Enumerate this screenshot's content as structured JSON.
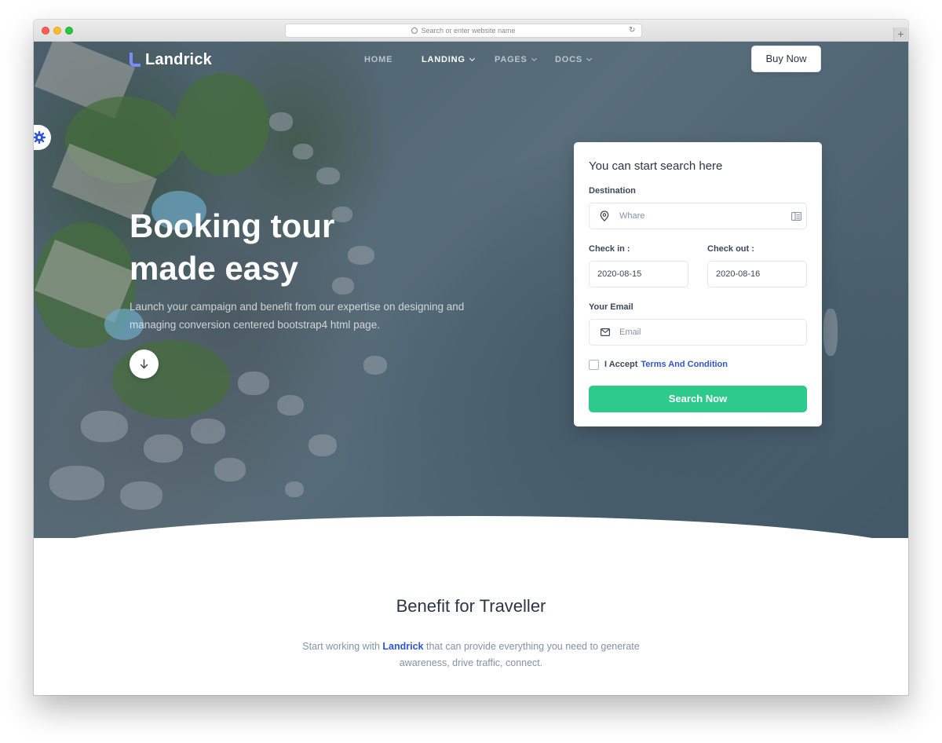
{
  "browser": {
    "url_placeholder": "Search or enter website name",
    "new_tab": "+"
  },
  "nav": {
    "logo": "Landrick",
    "items": [
      {
        "label": "HOME"
      },
      {
        "label": "LANDING"
      },
      {
        "label": "PAGES"
      },
      {
        "label": "DOCS"
      }
    ],
    "buy_button": "Buy Now"
  },
  "hero": {
    "title_line1": "Booking tour",
    "title_line2": "made easy",
    "subtitle": "Launch your campaign and benefit from our expertise on designing and managing conversion centered bootstrap4 html page."
  },
  "form": {
    "title": "You can start search here",
    "destination_label": "Destination",
    "destination_placeholder": "Whare",
    "checkin_label": "Check in :",
    "checkin_value": "2020-08-15",
    "checkout_label": "Check out :",
    "checkout_value": "2020-08-16",
    "email_label": "Your Email",
    "email_placeholder": "Email",
    "accept_text": "I Accept",
    "terms_link": "Terms And Condition",
    "submit": "Search Now"
  },
  "benefit": {
    "title": "Benefit for Traveller",
    "sub_pre": "Start working with",
    "sub_brand": "Landrick",
    "sub_post": "that can provide everything you need to generate awareness, drive traffic, connect."
  },
  "colors": {
    "primary": "#2f55d4",
    "success": "#2eca8b",
    "heading": "#2c3546",
    "muted": "#8492a6"
  }
}
